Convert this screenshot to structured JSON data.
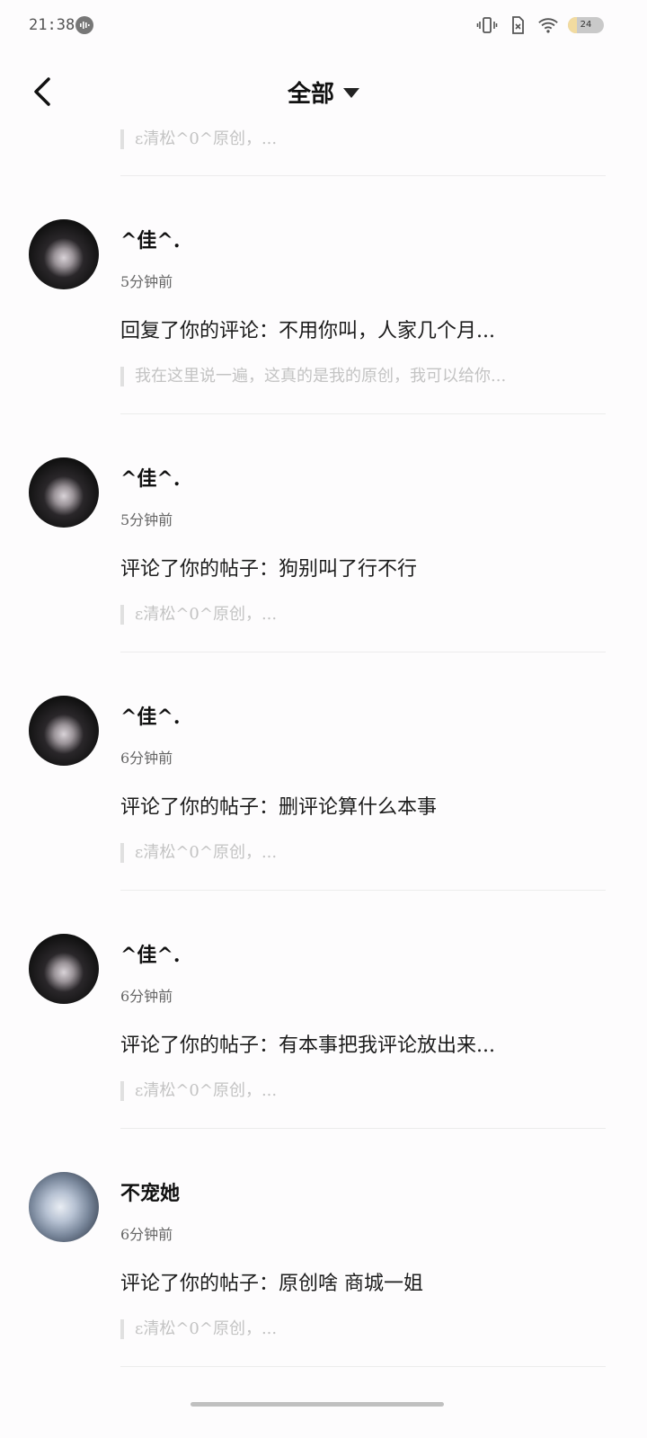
{
  "status_bar": {
    "time": "21:38",
    "app_indicator_icon": "voice-icon",
    "icons": [
      "vibrate-icon",
      "no-sim-icon",
      "wifi-icon"
    ],
    "battery_level": "24"
  },
  "header": {
    "back_icon": "chevron-left-icon",
    "title": "全部",
    "dropdown_icon": "caret-down-icon"
  },
  "partial_top_quote": "ε清松^0^原创，...",
  "notifications": [
    {
      "username": "^佳^.",
      "time": "5分钟前",
      "action": "回复了你的评论：不用你叫，人家几个月...",
      "quote": "我在这里说一遍，这真的是我的原创，我可以给你...",
      "avatar_style": "dark"
    },
    {
      "username": "^佳^.",
      "time": "5分钟前",
      "action": "评论了你的帖子：狗别叫了行不行",
      "quote": "ε清松^0^原创，...",
      "avatar_style": "dark"
    },
    {
      "username": "^佳^.",
      "time": "6分钟前",
      "action": "评论了你的帖子：删评论算什么本事",
      "quote": "ε清松^0^原创，...",
      "avatar_style": "dark"
    },
    {
      "username": "^佳^.",
      "time": "6分钟前",
      "action": "评论了你的帖子：有本事把我评论放出来...",
      "quote": "ε清松^0^原创，...",
      "avatar_style": "dark"
    },
    {
      "username": "不宠她",
      "time": "6分钟前",
      "action": "评论了你的帖子：原创啥 商城一姐",
      "quote": "ε清松^0^原创，...",
      "avatar_style": "light"
    }
  ]
}
